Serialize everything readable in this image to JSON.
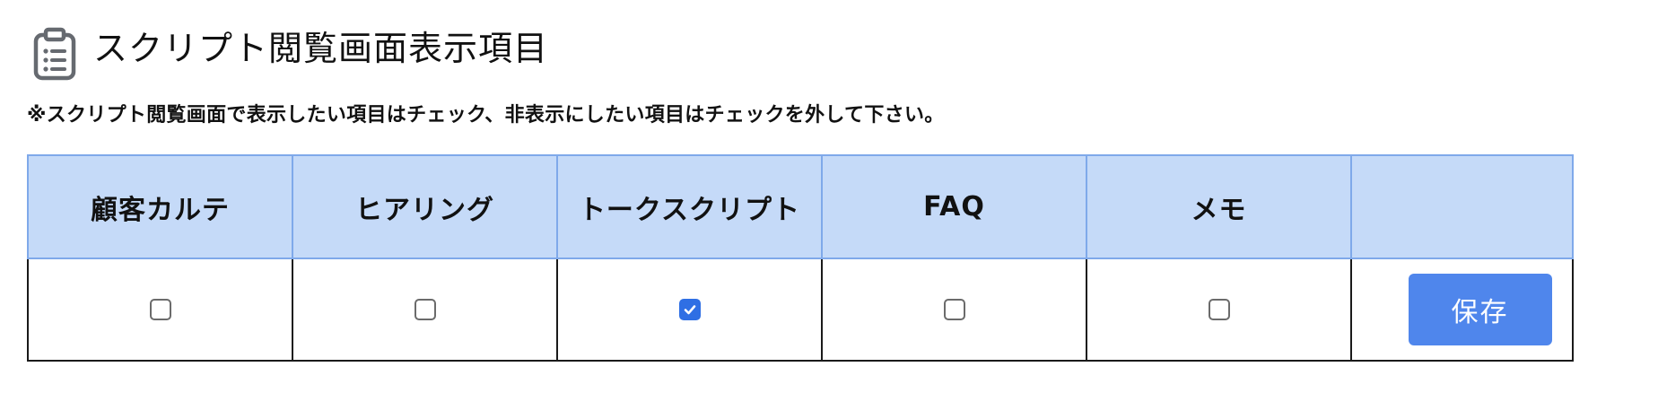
{
  "header": {
    "icon": "clipboard-list-icon",
    "title": "スクリプト閲覧画面表示項目"
  },
  "instruction": "※スクリプト閲覧画面で表示したい項目はチェック、非表示にしたい項目はチェックを外して下さい。",
  "table": {
    "columns": [
      {
        "label": "顧客カルテ",
        "checked": false
      },
      {
        "label": "ヒアリング",
        "checked": false
      },
      {
        "label": "トークスクリプト",
        "checked": true
      },
      {
        "label": "FAQ",
        "checked": false
      },
      {
        "label": "メモ",
        "checked": false
      }
    ],
    "save_label": "保存"
  },
  "colors": {
    "header_bg": "#c5daf8",
    "header_border": "#7fa9ea",
    "accent": "#4f86ec",
    "checkbox_checked": "#2f6fe4"
  }
}
